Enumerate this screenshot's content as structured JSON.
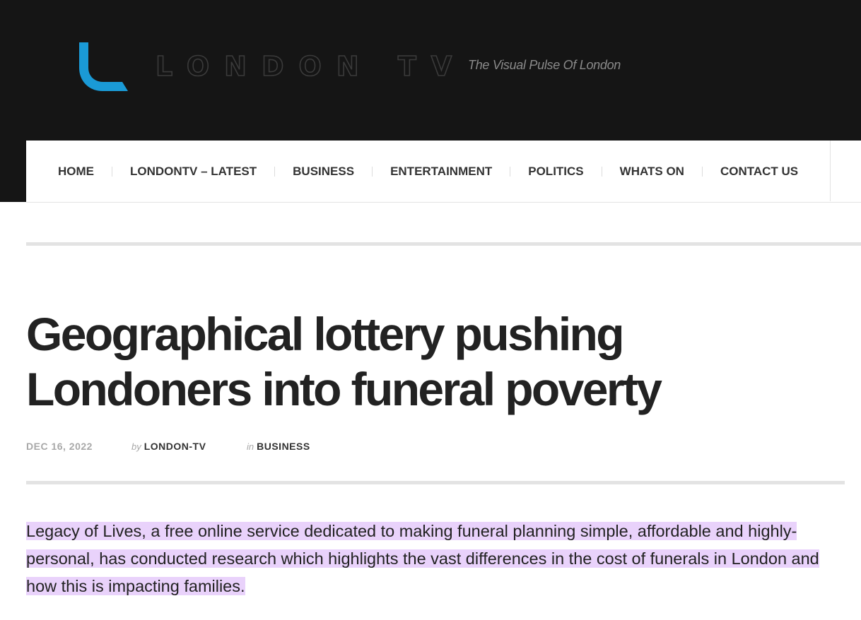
{
  "site": {
    "logo_text": "LONDON TV",
    "tagline": "The Visual Pulse Of London",
    "accent_color": "#1a9ad6",
    "logo_icon": "london-tv-l-mark"
  },
  "nav": {
    "items": [
      {
        "label": "HOME"
      },
      {
        "label": "LONDONTV – LATEST"
      },
      {
        "label": "BUSINESS"
      },
      {
        "label": "ENTERTAINMENT"
      },
      {
        "label": "POLITICS"
      },
      {
        "label": "WHATS ON"
      },
      {
        "label": "CONTACT US"
      }
    ]
  },
  "article": {
    "title": "Geographical lottery pushing Londoners into funeral poverty",
    "date": "DEC 16, 2022",
    "by_prefix": "by",
    "author": "LONDON-TV",
    "in_prefix": "in",
    "category": "BUSINESS",
    "lead": "Legacy of Lives, a free online service dedicated to making funeral planning simple, affordable and highly-personal, has conducted research which highlights the vast differences in the cost of funerals in London and how this is impacting families.",
    "highlight_color": "#e9d2fb"
  }
}
